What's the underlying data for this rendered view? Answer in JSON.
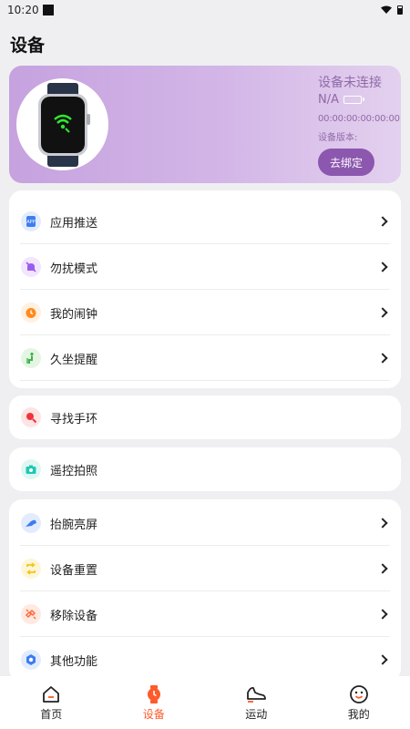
{
  "status_bar": {
    "time": "10:20"
  },
  "page": {
    "title": "设备"
  },
  "device": {
    "status": "设备未连接",
    "battery": "N/A",
    "mac": "00:00:00:00:00:00",
    "version_label": "设备版本:",
    "bind_label": "去绑定"
  },
  "groups": [
    {
      "items": [
        {
          "label": "应用推送",
          "icon": "app-push-icon",
          "color": "#3d7df0",
          "chevron": true
        },
        {
          "label": "勿扰模式",
          "icon": "do-not-disturb-icon",
          "color": "#9b5cf0",
          "chevron": true
        },
        {
          "label": "我的闹钟",
          "icon": "alarm-icon",
          "color": "#ff8a1f",
          "chevron": true
        },
        {
          "label": "久坐提醒",
          "icon": "sedentary-icon",
          "color": "#3cb34a",
          "chevron": true
        }
      ]
    },
    {
      "items": [
        {
          "label": "寻找手环",
          "icon": "find-band-icon",
          "color": "#f0343b",
          "chevron": false
        }
      ]
    },
    {
      "items": [
        {
          "label": "遥控拍照",
          "icon": "camera-icon",
          "color": "#1fc8b4",
          "chevron": false
        }
      ]
    },
    {
      "items": [
        {
          "label": "抬腕亮屏",
          "icon": "raise-wrist-icon",
          "color": "#3d7df0",
          "chevron": true
        },
        {
          "label": "设备重置",
          "icon": "reset-icon",
          "color": "#f5c518",
          "chevron": true
        },
        {
          "label": "移除设备",
          "icon": "remove-device-icon",
          "color": "#ff6a3a",
          "chevron": true
        },
        {
          "label": "其他功能",
          "icon": "other-functions-icon",
          "color": "#3d7df0",
          "chevron": true
        }
      ]
    }
  ],
  "tabs": [
    {
      "label": "首页",
      "icon": "home-icon",
      "active": false
    },
    {
      "label": "设备",
      "icon": "device-icon",
      "active": true
    },
    {
      "label": "运动",
      "icon": "sport-shoe-icon",
      "active": false
    },
    {
      "label": "我的",
      "icon": "profile-icon",
      "active": false
    }
  ],
  "colors": {
    "accent": "#ff5a2a",
    "bind_button": "#8c57ae",
    "card_gradient_start": "#c6a2df"
  }
}
